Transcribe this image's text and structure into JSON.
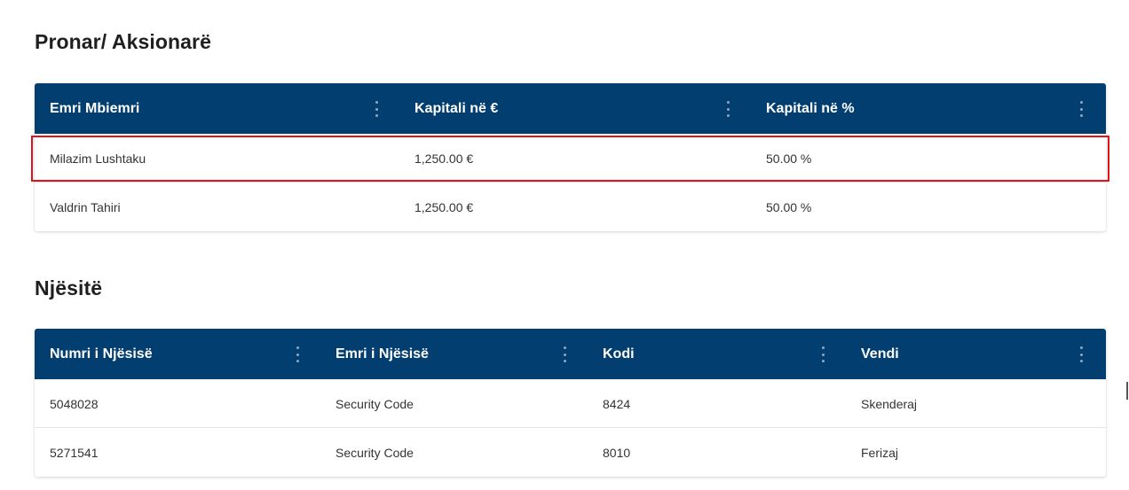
{
  "owners": {
    "title": "Pronar/ Aksionarë",
    "columns": [
      "Emri Mbiemri",
      "Kapitali në €",
      "Kapitali në %"
    ],
    "rows": [
      [
        "Milazim Lushtaku",
        "1,250.00 €",
        "50.00 %"
      ],
      [
        "Valdrin Tahiri",
        "1,250.00 €",
        "50.00 %"
      ]
    ],
    "highlighted_row": 0
  },
  "units": {
    "title": "Njësitë",
    "columns": [
      "Numri i Njësisë",
      "Emri i Njësisë",
      "Kodi",
      "Vendi"
    ],
    "rows": [
      [
        "5048028",
        "Security Code",
        "8424",
        "Skenderaj"
      ],
      [
        "5271541",
        "Security Code",
        "8010",
        "Ferizaj"
      ]
    ]
  },
  "icons": {
    "column_menu": "vertical-dots-icon"
  },
  "colors": {
    "header_bg": "#023f70",
    "header_text": "#ffffff",
    "highlight_border": "#e0121a"
  }
}
